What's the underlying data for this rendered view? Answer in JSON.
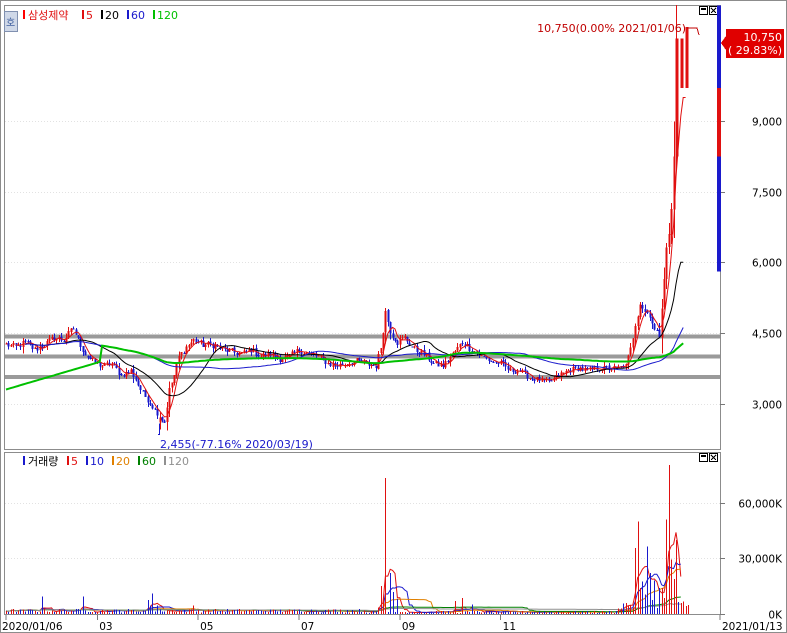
{
  "price_panel": {
    "stock_name": "삼성제약",
    "legend": [
      {
        "label": "5",
        "color": "#e01010"
      },
      {
        "label": "20",
        "color": "#000000"
      },
      {
        "label": "60",
        "color": "#1a1acc"
      },
      {
        "label": "120",
        "color": "#00c000"
      }
    ],
    "max_annotation": "10,750(0.00% 2021/01/06)",
    "min_annotation": "2,455(-77.16% 2020/03/19)",
    "current_price_tag": "10,750",
    "current_change_tag": "( 29.83%)",
    "side_icon": "호",
    "bullet_color": "#ff0000",
    "mini_bar_colors": [
      "#1a1acc",
      "#e01010",
      "#1a1acc"
    ]
  },
  "volume_panel": {
    "title": "거래량",
    "legend": [
      {
        "label": "5",
        "color": "#e01010"
      },
      {
        "label": "10",
        "color": "#1a1acc"
      },
      {
        "label": "20",
        "color": "#e08000"
      },
      {
        "label": "60",
        "color": "#008000"
      },
      {
        "label": "120",
        "color": "#909090"
      }
    ],
    "bullet_color": "#1a1acc"
  },
  "panel_icons": [
    "maximize-icon",
    "close-icon"
  ],
  "chart_data": {
    "type": "candlestick",
    "x_range": [
      "2020/01/06",
      "2021/01/13"
    ],
    "x_tick_labels": [
      "2020/01/06",
      "03",
      "05",
      "07",
      "09",
      "11",
      "2021/01/13"
    ],
    "price_y_ticks": [
      {
        "label": "3,000",
        "value": 3000
      },
      {
        "label": "4,500",
        "value": 4500
      },
      {
        "label": "6,000",
        "value": 6000
      },
      {
        "label": "7,500",
        "value": 7500
      },
      {
        "label": "9,000",
        "value": 9000
      }
    ],
    "price_ylim": [
      2100,
      11400
    ],
    "support_lines": [
      4420,
      4000,
      3560
    ],
    "close_anchors": [
      [
        0,
        4250
      ],
      [
        4,
        4200
      ],
      [
        8,
        4300
      ],
      [
        12,
        4150
      ],
      [
        16,
        4250
      ],
      [
        20,
        4400
      ],
      [
        24,
        4350
      ],
      [
        28,
        4600
      ],
      [
        30,
        4350
      ],
      [
        33,
        4050
      ],
      [
        36,
        3900
      ],
      [
        40,
        3800
      ],
      [
        44,
        3850
      ],
      [
        48,
        3600
      ],
      [
        52,
        3700
      ],
      [
        56,
        3300
      ],
      [
        60,
        3000
      ],
      [
        63,
        2800
      ],
      [
        66,
        2600
      ],
      [
        68,
        3300
      ],
      [
        70,
        3600
      ],
      [
        72,
        4000
      ],
      [
        75,
        4200
      ],
      [
        78,
        4350
      ],
      [
        82,
        4250
      ],
      [
        86,
        4250
      ],
      [
        90,
        4150
      ],
      [
        94,
        4100
      ],
      [
        98,
        4050
      ],
      [
        102,
        4150
      ],
      [
        106,
        4000
      ],
      [
        110,
        4050
      ],
      [
        114,
        3950
      ],
      [
        118,
        4000
      ],
      [
        122,
        4150
      ],
      [
        126,
        4050
      ],
      [
        130,
        4000
      ],
      [
        134,
        3850
      ],
      [
        138,
        3800
      ],
      [
        142,
        3850
      ],
      [
        146,
        3900
      ],
      [
        150,
        3850
      ],
      [
        154,
        3800
      ],
      [
        156,
        4200
      ],
      [
        158,
        4950
      ],
      [
        160,
        4550
      ],
      [
        163,
        4300
      ],
      [
        166,
        4400
      ],
      [
        170,
        4150
      ],
      [
        174,
        4050
      ],
      [
        178,
        3850
      ],
      [
        182,
        3800
      ],
      [
        186,
        4050
      ],
      [
        190,
        4300
      ],
      [
        194,
        4150
      ],
      [
        198,
        4000
      ],
      [
        202,
        3900
      ],
      [
        206,
        3850
      ],
      [
        210,
        3700
      ],
      [
        214,
        3700
      ],
      [
        218,
        3550
      ],
      [
        222,
        3500
      ],
      [
        226,
        3450
      ],
      [
        230,
        3600
      ],
      [
        234,
        3700
      ],
      [
        238,
        3750
      ],
      [
        242,
        3700
      ],
      [
        246,
        3750
      ],
      [
        250,
        3750
      ],
      [
        254,
        3750
      ],
      [
        258,
        3800
      ],
      [
        260,
        4150
      ],
      [
        262,
        4700
      ],
      [
        264,
        5150
      ],
      [
        266,
        4950
      ],
      [
        268,
        4900
      ],
      [
        270,
        4550
      ],
      [
        272,
        4450
      ],
      [
        273,
        5100
      ],
      [
        274,
        5700
      ],
      [
        275,
        6250
      ],
      [
        276,
        6600
      ],
      [
        277,
        7100
      ],
      [
        278,
        8250
      ],
      [
        279,
        10750
      ],
      [
        280,
        9700
      ],
      [
        281,
        9700
      ],
      [
        282,
        9700
      ],
      [
        283,
        9700
      ],
      [
        284,
        9800
      ],
      [
        285,
        10000
      ],
      [
        286,
        10500
      ],
      [
        287,
        11000
      ],
      [
        288,
        11450
      ]
    ],
    "min_point": {
      "date": "2020/03/19",
      "value": 2455,
      "change_pct": -77.16
    },
    "max_point": {
      "date": "2021/01/06",
      "value": 10750,
      "change_pct": 0.0
    },
    "last": {
      "value": 10750,
      "change_pct": 29.83
    },
    "volume_y_ticks": [
      {
        "label": "0K",
        "value": 0
      },
      {
        "label": "30,000K",
        "value": 30000
      },
      {
        "label": "60,000K",
        "value": 60000
      }
    ],
    "volume_ylim": [
      0,
      82000
    ],
    "volume_spikes": [
      [
        15,
        9500
      ],
      [
        32,
        9500
      ],
      [
        59,
        7500
      ],
      [
        60,
        4500
      ],
      [
        61,
        11000
      ],
      [
        63,
        4500
      ],
      [
        78,
        4500
      ],
      [
        155,
        3500
      ],
      [
        156,
        15000
      ],
      [
        157,
        9000
      ],
      [
        158,
        73500
      ],
      [
        160,
        22000
      ],
      [
        161,
        12000
      ],
      [
        163,
        8000
      ],
      [
        187,
        7000
      ],
      [
        190,
        8500
      ],
      [
        194,
        5000
      ],
      [
        262,
        35500
      ],
      [
        263,
        50000
      ],
      [
        264,
        14000
      ],
      [
        265,
        17500
      ],
      [
        266,
        10500
      ],
      [
        267,
        36500
      ],
      [
        268,
        22000
      ],
      [
        270,
        18000
      ],
      [
        272,
        14000
      ],
      [
        273,
        14000
      ],
      [
        274,
        8500
      ],
      [
        275,
        51000
      ],
      [
        276,
        80500
      ],
      [
        277,
        29500
      ],
      [
        278,
        19000
      ],
      [
        279,
        40000
      ]
    ]
  }
}
